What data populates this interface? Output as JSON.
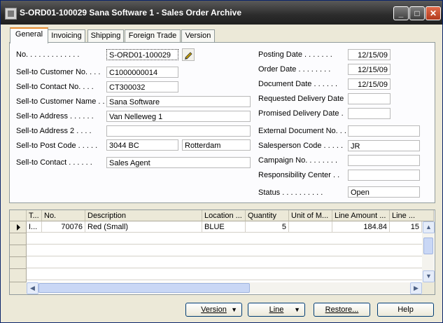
{
  "window": {
    "title": "S-ORD01-100029 Sana Software 1 - Sales Order Archive",
    "controls": {
      "minimize": "_",
      "maximize": "□",
      "close": "✕"
    }
  },
  "tabs": [
    "General",
    "Invoicing",
    "Shipping",
    "Foreign Trade",
    "Version"
  ],
  "general": {
    "no": {
      "label": "No. . . . . . . . . . . . .",
      "value": "S-ORD01-100029"
    },
    "sell_to_customer_no": {
      "label": "Sell-to Customer No. . . .",
      "value": "C1000000014"
    },
    "sell_to_contact_no": {
      "label": "Sell-to Contact No. . . .",
      "value": "CT300032"
    },
    "sell_to_customer_name": {
      "label": "Sell-to Customer Name . .",
      "value": "Sana Software"
    },
    "sell_to_address": {
      "label": "Sell-to Address . . . . . .",
      "value": "Van Nelleweg 1"
    },
    "sell_to_address_2": {
      "label": "Sell-to Address 2 . . . .",
      "value": ""
    },
    "sell_to_post_code": {
      "label": "Sell-to Post Code . . . . .",
      "value": "3044 BC",
      "city": "Rotterdam"
    },
    "sell_to_contact": {
      "label": "Sell-to Contact . . . . . .",
      "value": "Sales Agent"
    },
    "posting_date": {
      "label": "Posting Date . . . . . . .",
      "value": "12/15/09"
    },
    "order_date": {
      "label": "Order Date . . . . . . . .",
      "value": "12/15/09"
    },
    "document_date": {
      "label": "Document Date . . . . . .",
      "value": "12/15/09"
    },
    "requested_delivery_date": {
      "label": "Requested Delivery Date",
      "value": ""
    },
    "promised_delivery_date": {
      "label": "Promised Delivery Date .",
      "value": ""
    },
    "external_document_no": {
      "label": "External Document No. . .",
      "value": ""
    },
    "salesperson_code": {
      "label": "Salesperson Code . . . . .",
      "value": "JR"
    },
    "campaign_no": {
      "label": "Campaign No. . . . . . . .",
      "value": ""
    },
    "responsibility_center": {
      "label": "Responsibility Center . .",
      "value": ""
    },
    "status": {
      "label": "Status . . . . . . . . . .",
      "value": "Open"
    }
  },
  "lines": {
    "columns": [
      "T...",
      "No.",
      "Description",
      "Location ...",
      "Quantity",
      "Unit of M...",
      "Line Amount ...",
      "Line ..."
    ],
    "rows": [
      {
        "type": "I...",
        "no": "70076",
        "description": "Red (Small)",
        "location": "BLUE",
        "quantity": "5",
        "uom": "",
        "line_amount": "184.84",
        "line": "15"
      }
    ]
  },
  "buttons": {
    "version": "Version",
    "line": "Line",
    "restore": "Restore...",
    "help": "Help"
  }
}
